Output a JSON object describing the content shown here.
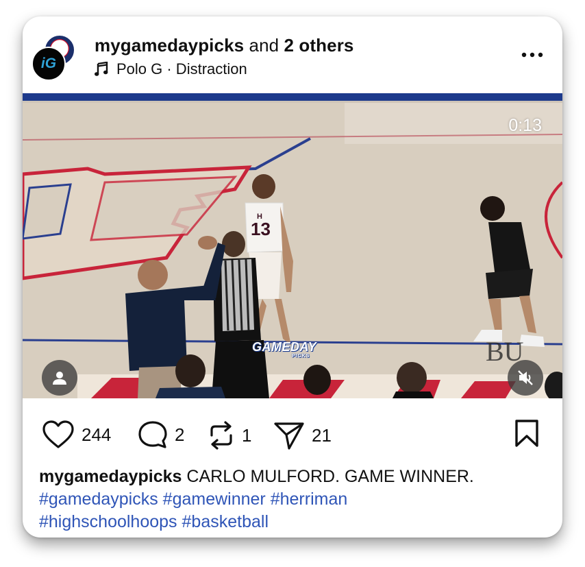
{
  "post": {
    "username": "mygamedaypicks",
    "collab_joiner": "and",
    "collab_others": "2 others",
    "music": "Polo G · Distraction",
    "video_time": "0:13",
    "watermark": "GAMEDAY",
    "watermark_sub": "PICKS",
    "likes": "244",
    "comments": "2",
    "reposts": "1",
    "shares": "21",
    "caption_user": "mygamedaypicks",
    "caption_text": "CARLO MULFORD. GAME WINNER.",
    "hashtags": [
      "#gamedaypicks",
      "#gamewinner",
      "#herriman",
      "#highschoolhoops",
      "#basketball"
    ],
    "jersey_number": "13",
    "jersey_letter": "H",
    "court_logo_text": "BU",
    "avatar_text": "iG"
  },
  "colors": {
    "hashtag": "#2f55b7",
    "court_floor": "#dad0c3",
    "court_blue": "#1d3a8c",
    "court_red": "#c8243a"
  },
  "icons": {
    "music": "music-note-icon",
    "more": "ellipsis-icon",
    "like": "heart-icon",
    "comment": "comment-bubble-icon",
    "repost": "repost-arrows-icon",
    "share": "send-paper-plane-icon",
    "save": "bookmark-icon",
    "tagged_people": "person-icon",
    "mute": "speaker-muted-icon"
  }
}
